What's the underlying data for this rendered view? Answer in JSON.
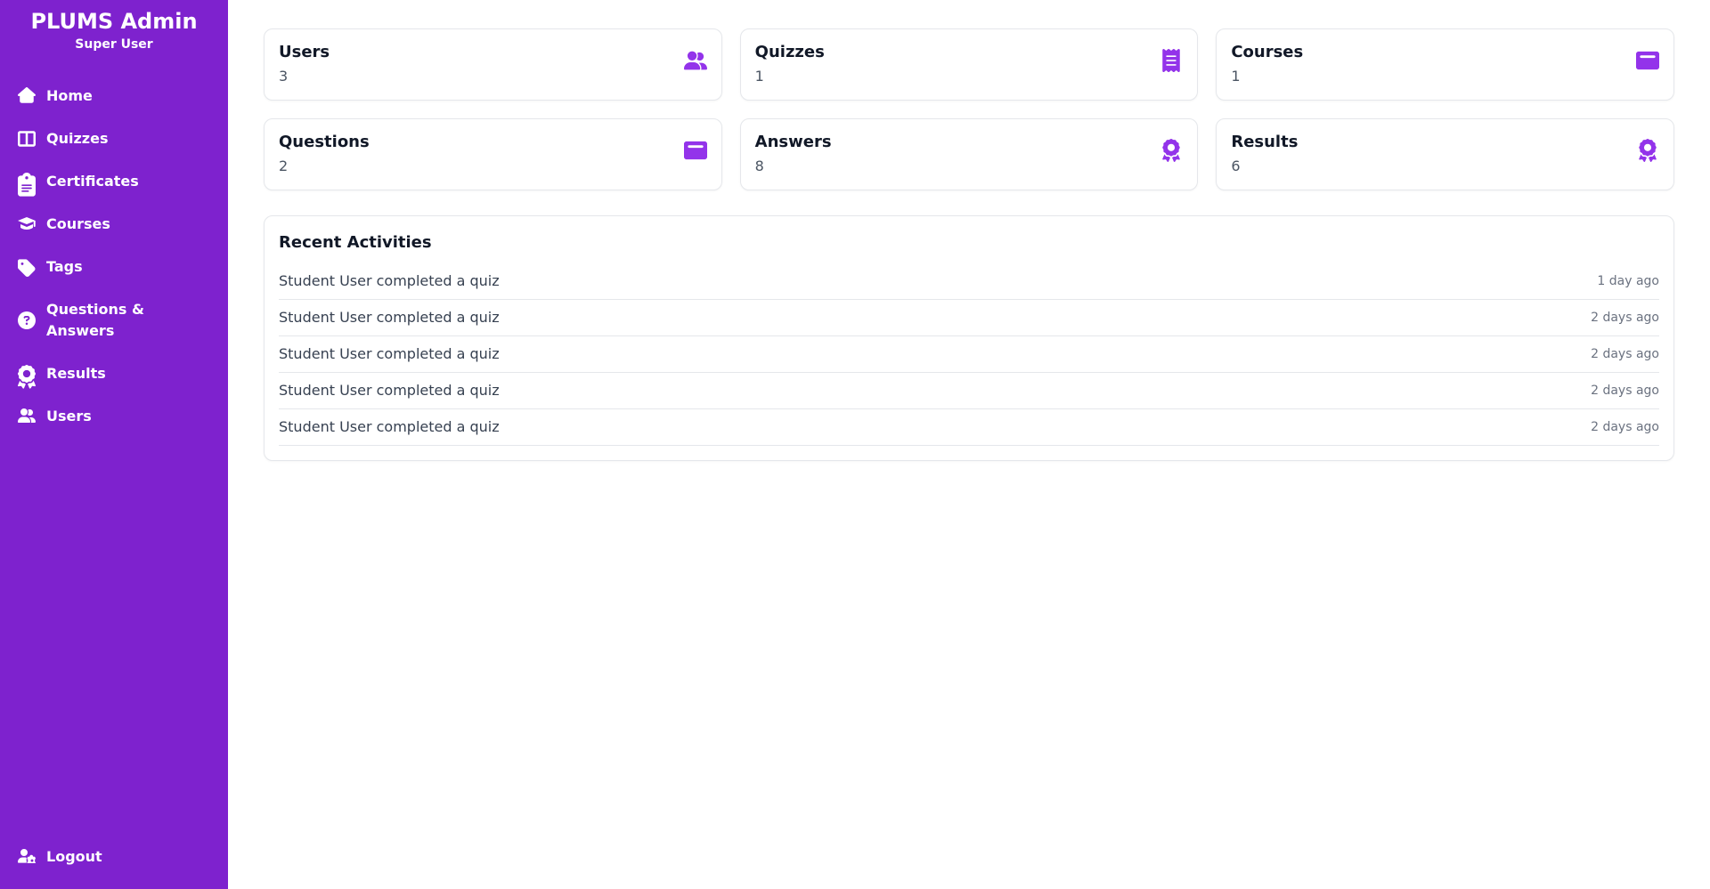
{
  "brand": {
    "title": "PLUMS Admin",
    "subtitle": "Super User"
  },
  "sidebar": {
    "items": [
      {
        "label": "Home"
      },
      {
        "label": "Quizzes"
      },
      {
        "label": "Certificates"
      },
      {
        "label": "Courses"
      },
      {
        "label": "Tags"
      },
      {
        "label": "Questions & Answers"
      },
      {
        "label": "Results"
      },
      {
        "label": "Users"
      }
    ],
    "logout_label": "Logout"
  },
  "cards": [
    {
      "title": "Users",
      "value": "3"
    },
    {
      "title": "Quizzes",
      "value": "1"
    },
    {
      "title": "Courses",
      "value": "1"
    },
    {
      "title": "Questions",
      "value": "2"
    },
    {
      "title": "Answers",
      "value": "8"
    },
    {
      "title": "Results",
      "value": "6"
    }
  ],
  "recent": {
    "title": "Recent Activities",
    "items": [
      {
        "desc": "Student User completed a quiz",
        "time": "1 day ago"
      },
      {
        "desc": "Student User completed a quiz",
        "time": "2 days ago"
      },
      {
        "desc": "Student User completed a quiz",
        "time": "2 days ago"
      },
      {
        "desc": "Student User completed a quiz",
        "time": "2 days ago"
      },
      {
        "desc": "Student User completed a quiz",
        "time": "2 days ago"
      }
    ]
  }
}
